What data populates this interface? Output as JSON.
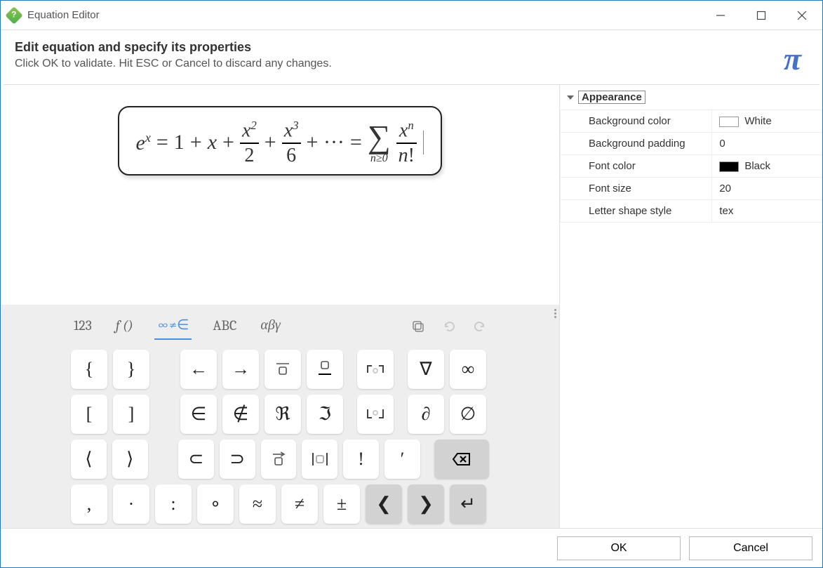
{
  "window": {
    "title": "Equation Editor"
  },
  "header": {
    "title": "Edit equation and specify its properties",
    "sub": "Click OK to validate. Hit ESC or Cancel to discard any changes."
  },
  "equation": {
    "latex": "e^x = 1 + x + \\frac{x^2}{2} + \\frac{x^3}{6} + \\cdots = \\sum_{n\\ge 0} \\frac{x^n}{n!}"
  },
  "tabs": {
    "t1": "123",
    "t2": "f ()",
    "t3": "∞≠∈",
    "t4": "ABC",
    "t5": "αβγ",
    "active": "t3"
  },
  "keys": {
    "r1": [
      "{",
      "}",
      "←",
      "→",
      "▭̄",
      "▭̲",
      "⌈∘⌉",
      "∇",
      "∞"
    ],
    "r2": [
      "[",
      "]",
      "∈",
      "∉",
      "ℜ",
      "ℑ",
      "⌊∘⌋",
      "∂",
      "∅"
    ],
    "r3": [
      "⟨",
      "⟩",
      "⊂",
      "⊃",
      "▭⃗",
      "|▭|",
      "!",
      "′",
      "⌫"
    ],
    "r4": [
      ",",
      "·",
      ":",
      "∘",
      "≈",
      "≠",
      "±",
      "❮",
      "❯",
      "↵"
    ]
  },
  "properties": {
    "section": "Appearance",
    "rows": [
      {
        "label": "Background color",
        "value": "White",
        "swatch": "#ffffff"
      },
      {
        "label": "Background padding",
        "value": "0"
      },
      {
        "label": "Font color",
        "value": "Black",
        "swatch": "#000000"
      },
      {
        "label": "Font size",
        "value": "20"
      },
      {
        "label": "Letter shape style",
        "value": "tex"
      }
    ]
  },
  "footer": {
    "ok": "OK",
    "cancel": "Cancel"
  }
}
